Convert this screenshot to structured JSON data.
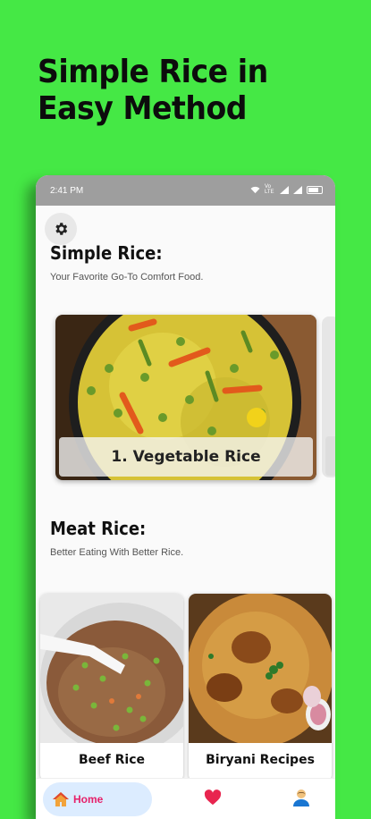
{
  "promo": {
    "line1": "Simple Rice in",
    "line2": "Easy Method"
  },
  "status_bar": {
    "time": "2:41 PM",
    "network_label": "Vo LTE"
  },
  "simple_section": {
    "title": "Simple Rice:",
    "subtitle": "Your Favorite Go-To Comfort Food."
  },
  "carousel": {
    "items": [
      {
        "label": "1. Vegetable Rice"
      }
    ]
  },
  "meat_section": {
    "title": "Meat Rice:",
    "subtitle": "Better Eating With Better Rice."
  },
  "meat_cards": [
    {
      "label": "Beef Rice"
    },
    {
      "label": "Biryani Recipes"
    }
  ],
  "bottom_nav": {
    "home_label": "Home"
  },
  "icons": {
    "settings": "gear-icon",
    "home": "home-icon",
    "favorites": "heart-icon",
    "profile": "person-icon"
  },
  "colors": {
    "background": "#45e845",
    "home_pill": "#dcecff",
    "accent": "#e6206a",
    "heart": "#e8254f",
    "profile": "#1976d2"
  }
}
